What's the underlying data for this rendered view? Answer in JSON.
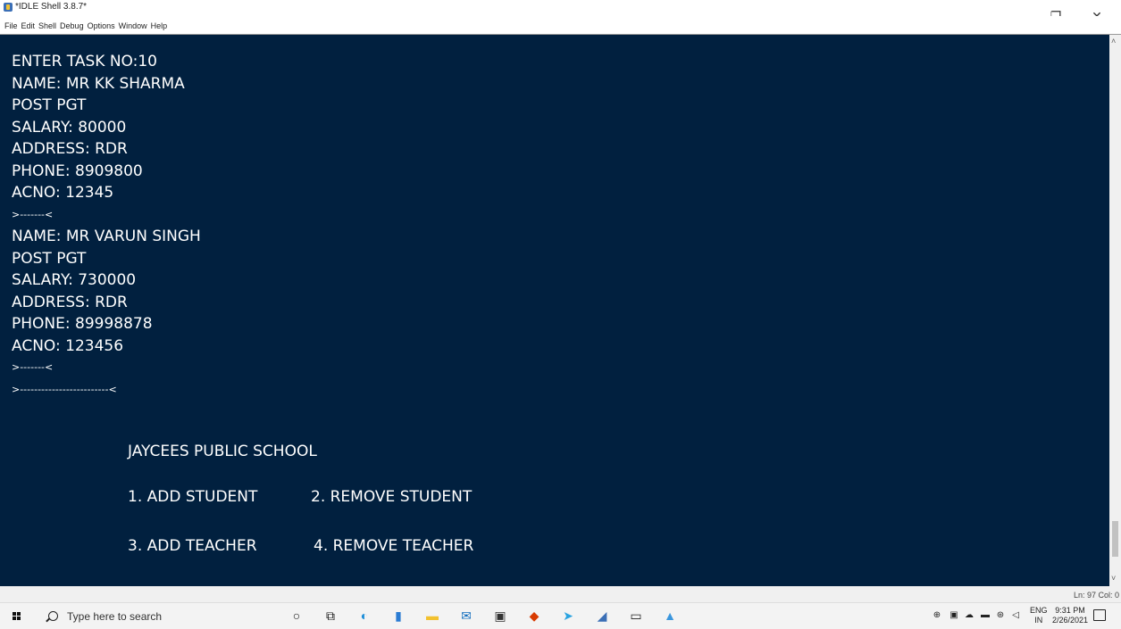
{
  "window": {
    "title": "*IDLE Shell 3.8.7*",
    "minimize": "–",
    "restore": "❐",
    "close": "✕"
  },
  "menu": [
    "File",
    "Edit",
    "Shell",
    "Debug",
    "Options",
    "Window",
    "Help"
  ],
  "shell": {
    "lines": [
      "ENTER TASK NO:10",
      "NAME: MR KK SHARMA",
      "POST PGT",
      "SALARY: 80000",
      "ADDRESS: RDR",
      "PHONE: 8909800",
      "ACNO: 12345",
      ">-------<",
      "NAME: MR VARUN SINGH",
      "POST PGT",
      "SALARY: 730000",
      "ADDRESS: RDR",
      "PHONE: 89998878",
      "ACNO: 123456",
      ">-------<",
      ">-------------------------<"
    ],
    "menu_title": "JAYCEES PUBLIC SCHOOL",
    "options": [
      "1. ADD STUDENT",
      "2. REMOVE STUDENT",
      "3. ADD TEACHER",
      "4. REMOVE TEACHER"
    ],
    "background": "#01203f"
  },
  "status": {
    "text": "Ln: 97  Col: 0"
  },
  "taskbar": {
    "search_placeholder": "Type here to search",
    "icons": [
      "cortana-icon",
      "task-view-icon",
      "edge-icon",
      "file-icon",
      "explorer-icon",
      "mail-icon",
      "store-icon",
      "office-icon",
      "telegram-icon",
      "idle-icon",
      "terminal-icon",
      "photos-icon"
    ],
    "lang1": "ENG",
    "lang2": "IN",
    "time": "9:31 PM",
    "date": "2/26/2021"
  }
}
